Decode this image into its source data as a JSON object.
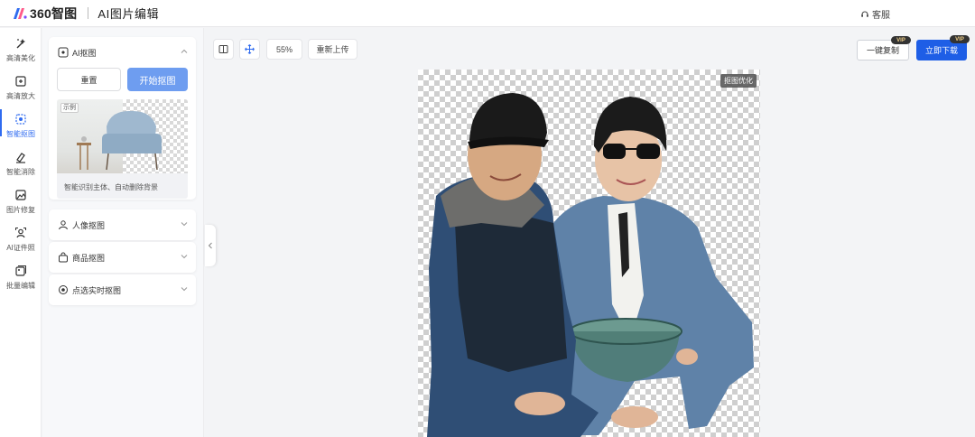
{
  "header": {
    "logo_text": "360智图",
    "app_title": "AI图片编辑",
    "service_label": "客服",
    "brand_color": "#2f6bf0"
  },
  "rail": {
    "items": [
      {
        "label": "高清美化",
        "icon": "magic-wand-icon"
      },
      {
        "label": "高清放大",
        "icon": "enlarge-icon"
      },
      {
        "label": "智能抠图",
        "icon": "cutout-icon",
        "active": true
      },
      {
        "label": "智能消除",
        "icon": "eraser-icon"
      },
      {
        "label": "图片修复",
        "icon": "image-repair-icon"
      },
      {
        "label": "AI证件照",
        "icon": "id-photo-icon"
      },
      {
        "label": "批量编辑",
        "icon": "batch-edit-icon"
      }
    ]
  },
  "panel": {
    "ai_cutout": {
      "title": "AI抠图",
      "reset_label": "重置",
      "start_label": "开始抠图",
      "example_tag": "示例",
      "example_caption": "智能识别主体、自动删除背景"
    },
    "sections": [
      {
        "title": "人像抠图",
        "icon": "person-icon"
      },
      {
        "title": "商品抠图",
        "icon": "bag-icon"
      },
      {
        "title": "点选实时抠图",
        "icon": "target-icon"
      }
    ]
  },
  "toolbar": {
    "zoom": "55%",
    "reupload_label": "重新上传",
    "copy_label": "一键复制",
    "download_label": "立即下载",
    "vip_badge": "VIP"
  },
  "canvas": {
    "optimize_label": "抠图优化"
  }
}
